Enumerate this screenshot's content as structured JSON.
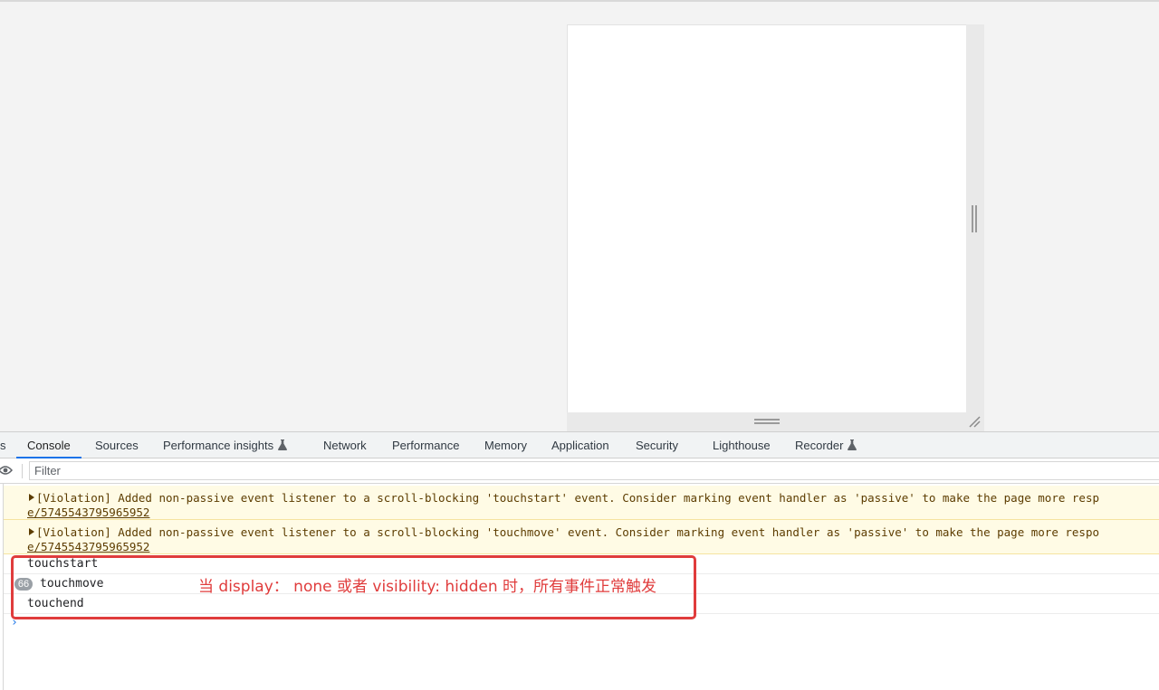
{
  "devtools": {
    "tabs": [
      {
        "label": "s"
      },
      {
        "label": "Console"
      },
      {
        "label": "Sources"
      },
      {
        "label": "Performance insights"
      },
      {
        "label": "Network"
      },
      {
        "label": "Performance"
      },
      {
        "label": "Memory"
      },
      {
        "label": "Application"
      },
      {
        "label": "Security"
      },
      {
        "label": "Lighthouse"
      },
      {
        "label": "Recorder"
      }
    ],
    "active_tab": "Console",
    "filter": {
      "placeholder": "Filter",
      "value": ""
    }
  },
  "console": {
    "warnings": [
      {
        "message": "[Violation] Added non-passive event listener to a scroll-blocking 'touchstart' event. Consider marking event handler as 'passive' to make the page more resp",
        "link": "e/5745543795965952"
      },
      {
        "message": "[Violation] Added non-passive event listener to a scroll-blocking 'touchmove' event. Consider marking event handler as 'passive' to make the page more respo",
        "link": "e/5745543795965952"
      }
    ],
    "logs": [
      {
        "text": "touchstart",
        "count": ""
      },
      {
        "text": "touchmove",
        "count": "66"
      },
      {
        "text": "touchend",
        "count": ""
      }
    ],
    "prompt": "›"
  },
  "annotation": {
    "text": "当 display：  none 或者 visibility: hidden 时，所有事件正常触发",
    "color": "#e03c3c"
  },
  "colors": {
    "accent": "#1a73e8",
    "warning_bg": "#fffbe5"
  }
}
